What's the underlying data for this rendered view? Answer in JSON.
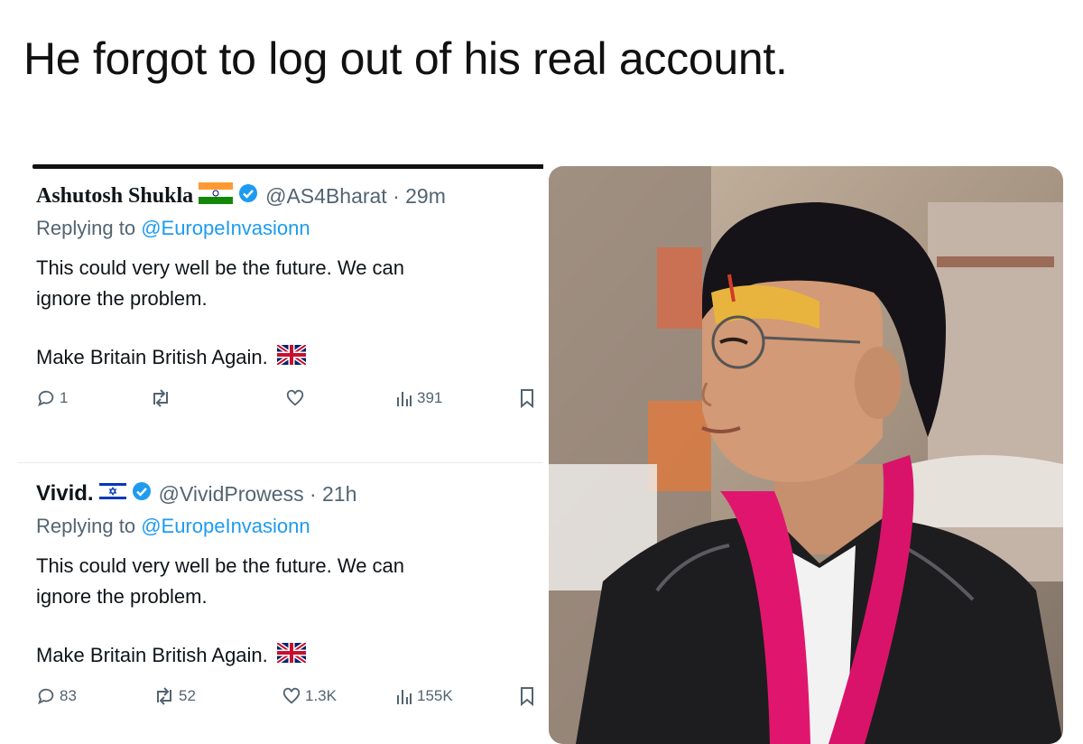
{
  "headline": "He forgot to log out of his real account.",
  "tweets": [
    {
      "name": "Ashutosh Shukla",
      "flag_icon": "india-flag-icon",
      "handle_time": "@AS4Bharat · 29m",
      "replying_prefix": "Replying to ",
      "replying_handle": "@EuropeInvasionn",
      "text_line1": "This could very well be the future. We can",
      "text_line2": "ignore the problem.",
      "text_line3": "Make Britain British Again.",
      "replies": "1",
      "retweets": "",
      "likes": "",
      "views": "391"
    },
    {
      "name": "Vivid.",
      "flag_icon": "israel-flag-icon",
      "handle_time": "@VividProwess · 21h",
      "replying_prefix": "Replying to ",
      "replying_handle": "@EuropeInvasionn",
      "text_line1": "This could very well be the future. We can",
      "text_line2": "ignore the problem.",
      "text_line3": "Make Britain British Again.",
      "replies": "83",
      "retweets": "52",
      "likes": "1.3K",
      "views": "155K"
    }
  ],
  "colors": {
    "accent": "#1d9bf0",
    "muted": "#536471",
    "scarf": "#e0166e"
  }
}
